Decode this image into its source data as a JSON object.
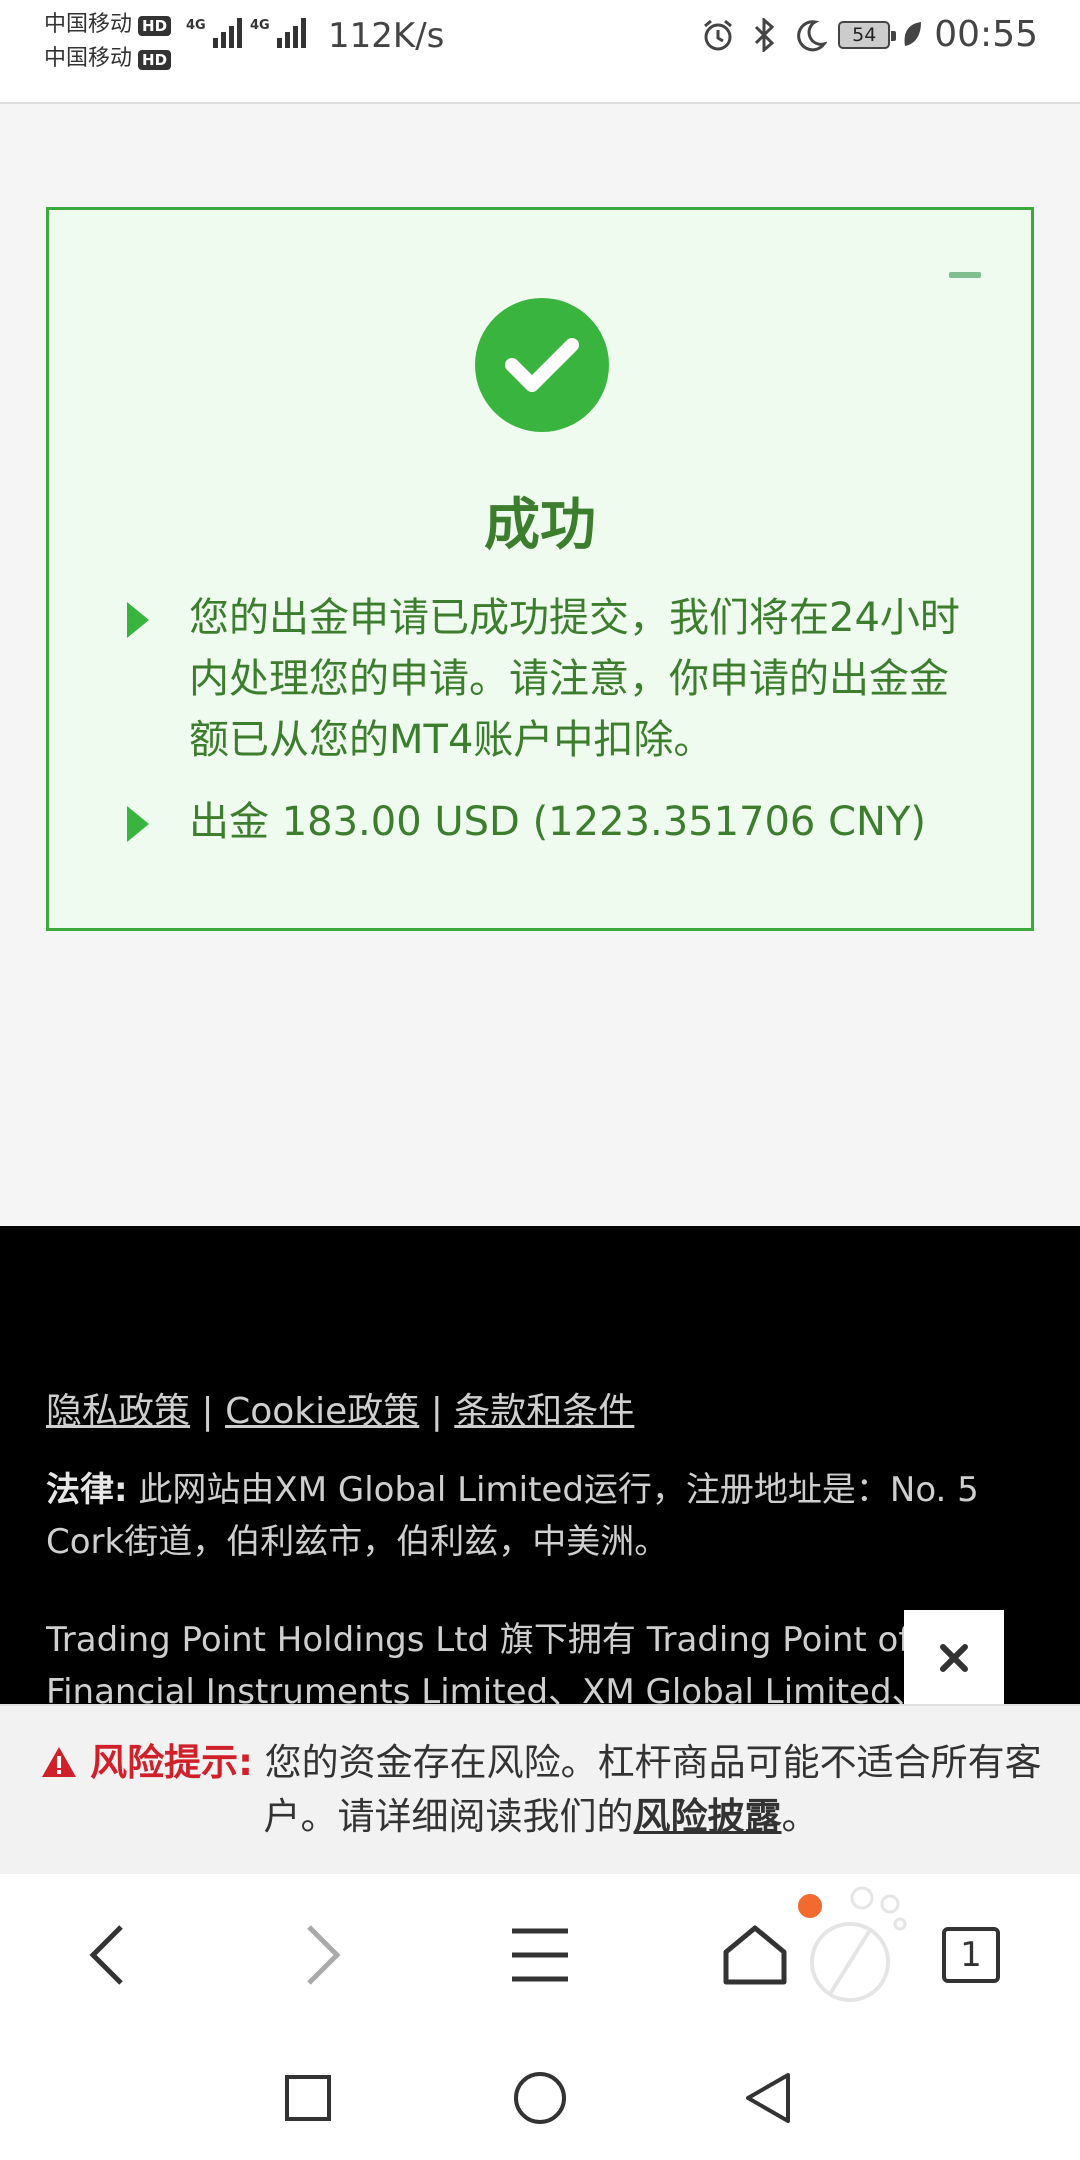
{
  "status_bar": {
    "carrier1": "中国移动",
    "carrier2": "中国移动",
    "hd_badge": "HD",
    "network_type": "4G",
    "net_speed": "112K/s",
    "battery_level": "54",
    "time": "00:55",
    "icons": [
      "alarm-icon",
      "bluetooth-icon",
      "moon-icon",
      "battery-icon",
      "leaf-icon"
    ]
  },
  "success_card": {
    "title": "成功",
    "bullet1": "您的出金申请已成功提交，我们将在24小时内处理您的申请。请注意，你申请的出金金额已从您的MT4账户中扣除。",
    "bullet2": "出金 183.00 USD (1223.351706 CNY)",
    "accent_color": "#39b53f",
    "text_color": "#3c7d2e"
  },
  "footer": {
    "link_privacy": "隐私政策",
    "link_cookie": "Cookie政策",
    "link_terms": "条款和条件",
    "separator": "|",
    "legal_label": "法律:",
    "legal_text": " 此网站由XM Global Limited运行，注册地址是：No. 5 Cork街道，伯利兹市，伯利兹，中美洲。",
    "holdings_line1": "Trading Point Holdings Ltd 旗下拥有 Trading Point of",
    "holdings_line2": "Financial Instruments Limited、XM Global Limited、"
  },
  "risk_banner": {
    "label": "风险提示:",
    "text": " 您的资金存在风险。杠杆商品可能不适合所有客户。请详细阅读我们的",
    "link": "风险披露",
    "end": "。",
    "warning_color": "#d0212a"
  },
  "browser_bar": {
    "tab_count": "1"
  }
}
